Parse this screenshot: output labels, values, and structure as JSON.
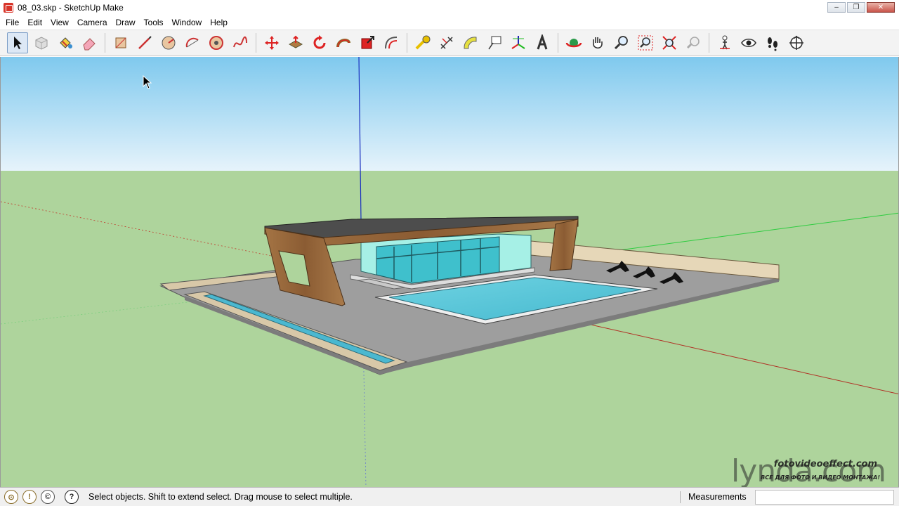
{
  "window": {
    "title": "08_03.skp - SketchUp Make",
    "controls": [
      "–",
      "❐",
      "✕"
    ]
  },
  "menu": {
    "items": [
      "File",
      "Edit",
      "View",
      "Camera",
      "Draw",
      "Tools",
      "Window",
      "Help"
    ]
  },
  "toolbar": {
    "tools": [
      {
        "name": "select-tool-icon",
        "active": true
      },
      {
        "name": "make-component-icon"
      },
      {
        "name": "paint-bucket-icon"
      },
      {
        "name": "eraser-icon"
      },
      {
        "name": "rectangle-icon"
      },
      {
        "name": "line-icon"
      },
      {
        "name": "circle-icon"
      },
      {
        "name": "arc-icon"
      },
      {
        "name": "polygon-icon"
      },
      {
        "name": "freehand-icon"
      },
      {
        "name": "move-icon"
      },
      {
        "name": "push-pull-icon"
      },
      {
        "name": "rotate-icon"
      },
      {
        "name": "follow-me-icon"
      },
      {
        "name": "scale-icon"
      },
      {
        "name": "offset-icon"
      },
      {
        "name": "tape-measure-icon"
      },
      {
        "name": "dimension-icon"
      },
      {
        "name": "protractor-icon"
      },
      {
        "name": "text-icon"
      },
      {
        "name": "axes-icon"
      },
      {
        "name": "3d-text-icon"
      },
      {
        "name": "orbit-icon"
      },
      {
        "name": "pan-icon"
      },
      {
        "name": "zoom-icon"
      },
      {
        "name": "zoom-window-icon"
      },
      {
        "name": "zoom-extents-icon"
      },
      {
        "name": "previous-view-icon"
      },
      {
        "name": "position-camera-icon"
      },
      {
        "name": "look-around-icon"
      },
      {
        "name": "walk-icon"
      },
      {
        "name": "section-plane-icon"
      }
    ]
  },
  "colors": {
    "sky_top": "#7fc9ee",
    "sky_bottom": "#e6f3fb",
    "ground": "#aed49c",
    "wood": "#9a6a3c",
    "pool_water": "#5cc6d8",
    "glass": "#3fc0cc",
    "axis_red": "#c0392b",
    "axis_green": "#2ecc40",
    "axis_blue": "#1a2fbf"
  },
  "watermark": {
    "logo": "lynda.com",
    "site": "fotovideoeffect.com",
    "tagline": "ВСЕ ДЛЯ ФОТО И ВИДЕО МОНТАЖА!"
  },
  "status": {
    "message": "Select objects. Shift to extend select. Drag mouse to select multiple.",
    "measurements_label": "Measurements",
    "measurements_value": ""
  }
}
